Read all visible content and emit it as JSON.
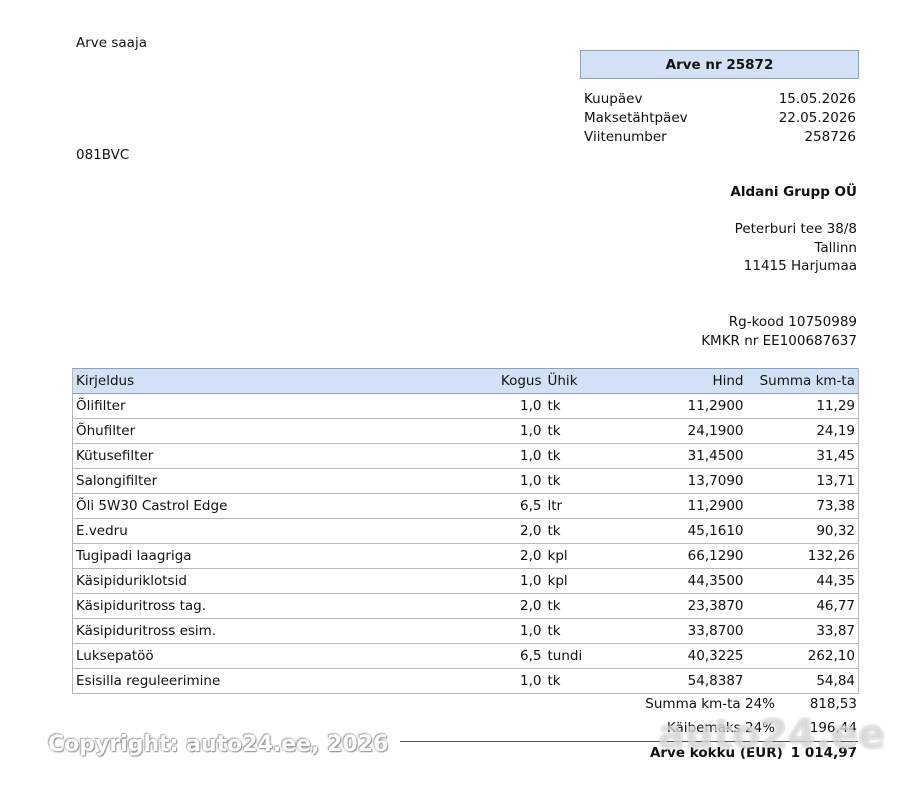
{
  "recipient": {
    "label": "Arve saaja",
    "code": "081BVC"
  },
  "invoice": {
    "title": "Arve nr 25872",
    "meta": [
      {
        "label": "Kuupäev",
        "value": "15.05.2026"
      },
      {
        "label": "Maksetähtpäev",
        "value": "22.05.2026"
      },
      {
        "label": "Viitenumber",
        "value": "258726"
      }
    ]
  },
  "company": {
    "name": "Aldani Grupp OÜ",
    "address": [
      "Peterburi tee 38/8",
      "Tallinn",
      "11415 Harjumaa"
    ],
    "reg_code": "Rg-kood 10750989",
    "vat_no": "KMKR nr EE100687637"
  },
  "table": {
    "headers": [
      "Kirjeldus",
      "Kogus",
      "Ühik",
      "Hind",
      "Summa km-ta"
    ],
    "rows": [
      [
        "Õlifilter",
        "1,0",
        "tk",
        "11,2900",
        "11,29"
      ],
      [
        "Õhufilter",
        "1,0",
        "tk",
        "24,1900",
        "24,19"
      ],
      [
        "Kütusefilter",
        "1,0",
        "tk",
        "31,4500",
        "31,45"
      ],
      [
        "Salongifilter",
        "1,0",
        "tk",
        "13,7090",
        "13,71"
      ],
      [
        "Õli 5W30 Castrol Edge",
        "6,5",
        "ltr",
        "11,2900",
        "73,38"
      ],
      [
        "E.vedru",
        "2,0",
        "tk",
        "45,1610",
        "90,32"
      ],
      [
        "Tugipadi laagriga",
        "2,0",
        "kpl",
        "66,1290",
        "132,26"
      ],
      [
        "Käsipiduriklotsid",
        "1,0",
        "kpl",
        "44,3500",
        "44,35"
      ],
      [
        "Käsipiduritross tag.",
        "2,0",
        "tk",
        "23,3870",
        "46,77"
      ],
      [
        "Käsipiduritross esim.",
        "1,0",
        "tk",
        "33,8700",
        "33,87"
      ],
      [
        "Luksepatöö",
        "6,5",
        "tundi",
        "40,3225",
        "262,10"
      ],
      [
        "Esisilla reguleerimine",
        "1,0",
        "tk",
        "54,8387",
        "54,84"
      ]
    ]
  },
  "totals": {
    "subtotal": {
      "label": "Summa km-ta 24%",
      "value": "818,53"
    },
    "vat": {
      "label": "Käibemaks 24%",
      "value": "196,44"
    },
    "total": {
      "label": "Arve kokku (EUR)",
      "value": "1 014,97"
    }
  },
  "watermark": {
    "text": "Copyright: auto24.ee, 2026",
    "logo": "auto24.ee"
  }
}
